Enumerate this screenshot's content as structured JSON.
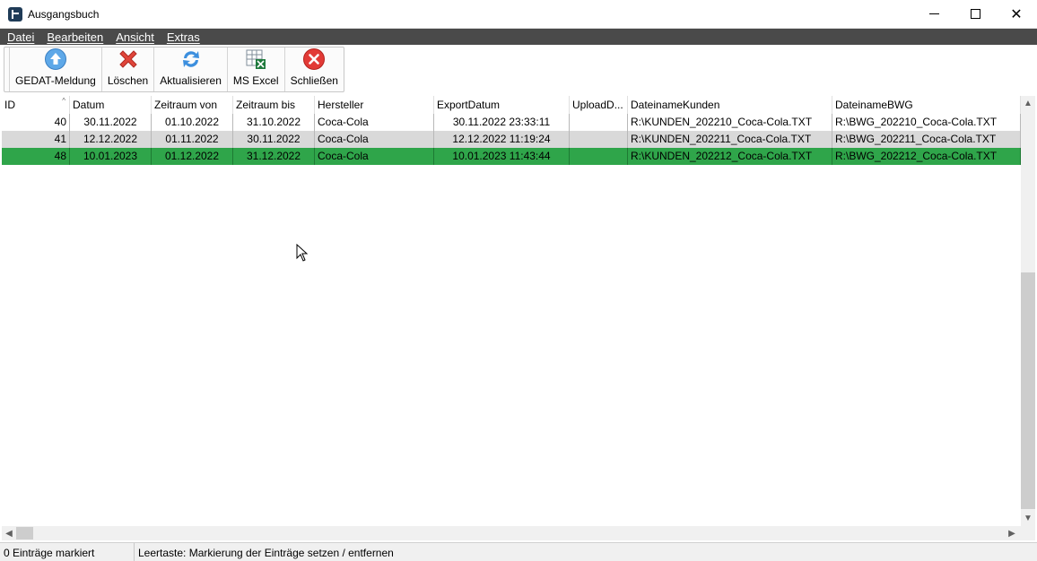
{
  "window": {
    "title": "Ausgangsbuch",
    "minimize": "–",
    "close": "✕"
  },
  "menu": {
    "items": [
      "Datei",
      "Bearbeiten",
      "Ansicht",
      "Extras"
    ]
  },
  "toolbar": {
    "gedat_label": "GEDAT-Meldung",
    "loeschen_label": "Löschen",
    "aktualisieren_label": "Aktualisieren",
    "excel_label": "MS Excel",
    "schliessen_label": "Schließen"
  },
  "grid": {
    "columns": [
      "ID",
      "Datum",
      "Zeitraum von",
      "Zeitraum bis",
      "Hersteller",
      "ExportDatum",
      "UploadD...",
      "DateinameKunden",
      "DateinameBWG"
    ],
    "sort_indicator": "^",
    "rows": [
      {
        "id": "40",
        "datum": "30.11.2022",
        "von": "01.10.2022",
        "bis": "31.10.2022",
        "hersteller": "Coca-Cola",
        "export": "30.11.2022 23:33:11",
        "upload": "",
        "kunden": "R:\\KUNDEN_202210_Coca-Cola.TXT",
        "bwg": "R:\\BWG_202210_Coca-Cola.TXT"
      },
      {
        "id": "41",
        "datum": "12.12.2022",
        "von": "01.11.2022",
        "bis": "30.11.2022",
        "hersteller": "Coca-Cola",
        "export": "12.12.2022 11:19:24",
        "upload": "",
        "kunden": "R:\\KUNDEN_202211_Coca-Cola.TXT",
        "bwg": "R:\\BWG_202211_Coca-Cola.TXT"
      },
      {
        "id": "48",
        "datum": "10.01.2023",
        "von": "01.12.2022",
        "bis": "31.12.2022",
        "hersteller": "Coca-Cola",
        "export": "10.01.2023 11:43:44",
        "upload": "",
        "kunden": "R:\\KUNDEN_202212_Coca-Cola.TXT",
        "bwg": "R:\\BWG_202212_Coca-Cola.TXT"
      }
    ]
  },
  "status": {
    "marked": "0 Einträge markiert",
    "hint": "Leertaste: Markierung der Einträge setzen / entfernen"
  },
  "colors": {
    "selected_row": "#2fa54a",
    "alt_row": "#d9d9d9",
    "menubar": "#4a4a4a"
  }
}
